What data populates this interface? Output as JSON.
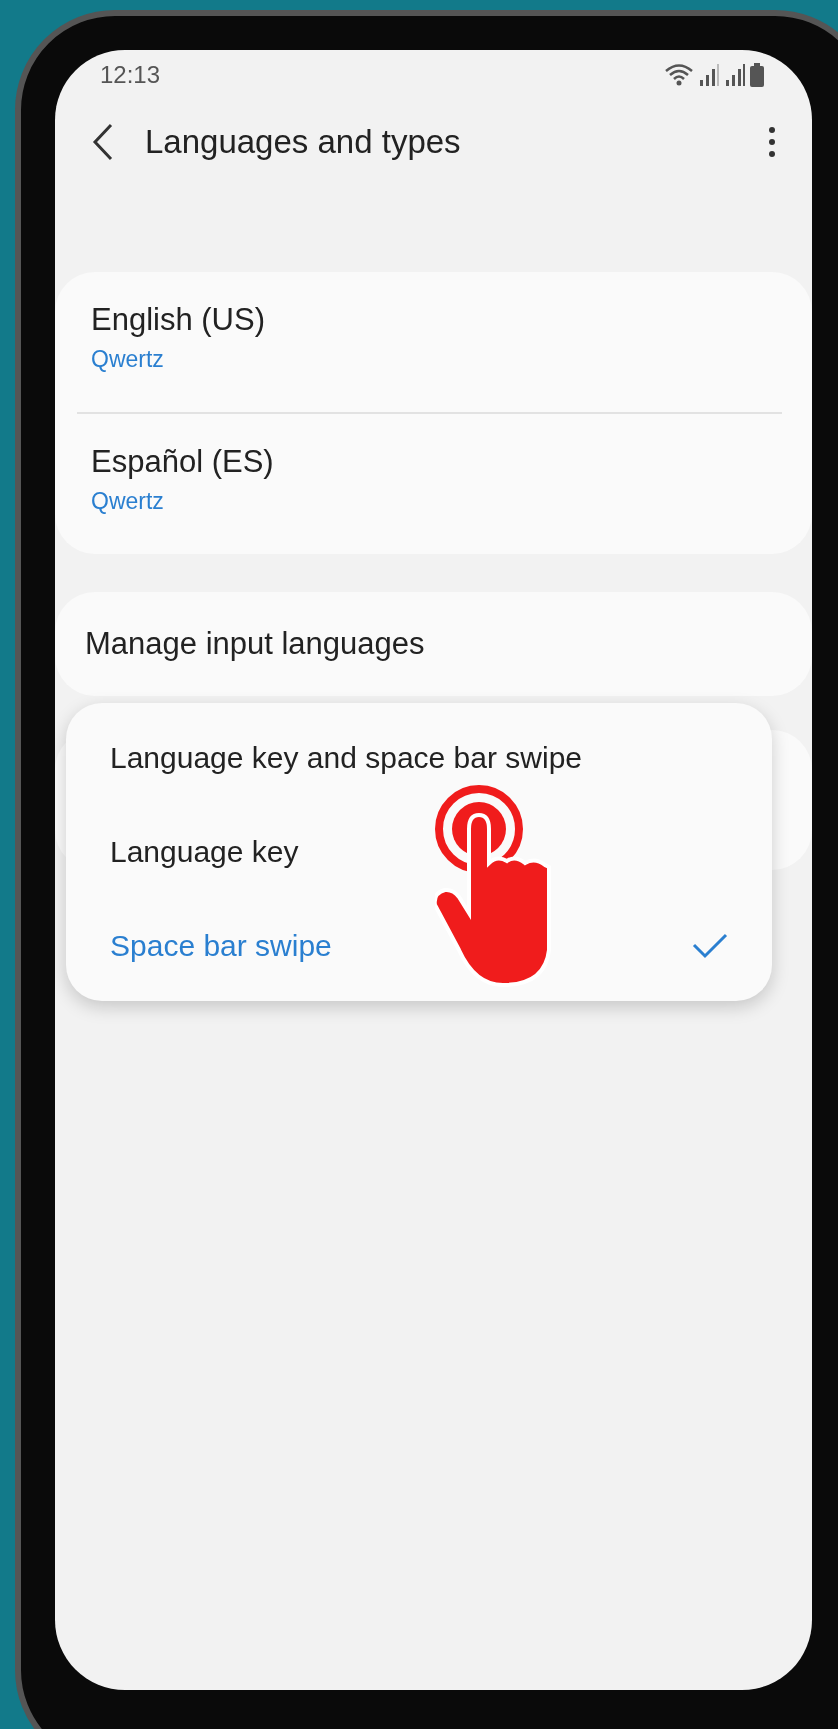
{
  "status_bar": {
    "time": "12:13"
  },
  "header": {
    "title": "Languages and types"
  },
  "languages": [
    {
      "name": "English (US)",
      "layout": "Qwertz"
    },
    {
      "name": "Español (ES)",
      "layout": "Qwertz"
    }
  ],
  "manage": {
    "label": "Manage input languages"
  },
  "switch_menu": {
    "options": [
      {
        "label": "Language key and space bar swipe",
        "selected": false
      },
      {
        "label": "Language key",
        "selected": false
      },
      {
        "label": "Space bar swipe",
        "selected": true
      }
    ]
  }
}
